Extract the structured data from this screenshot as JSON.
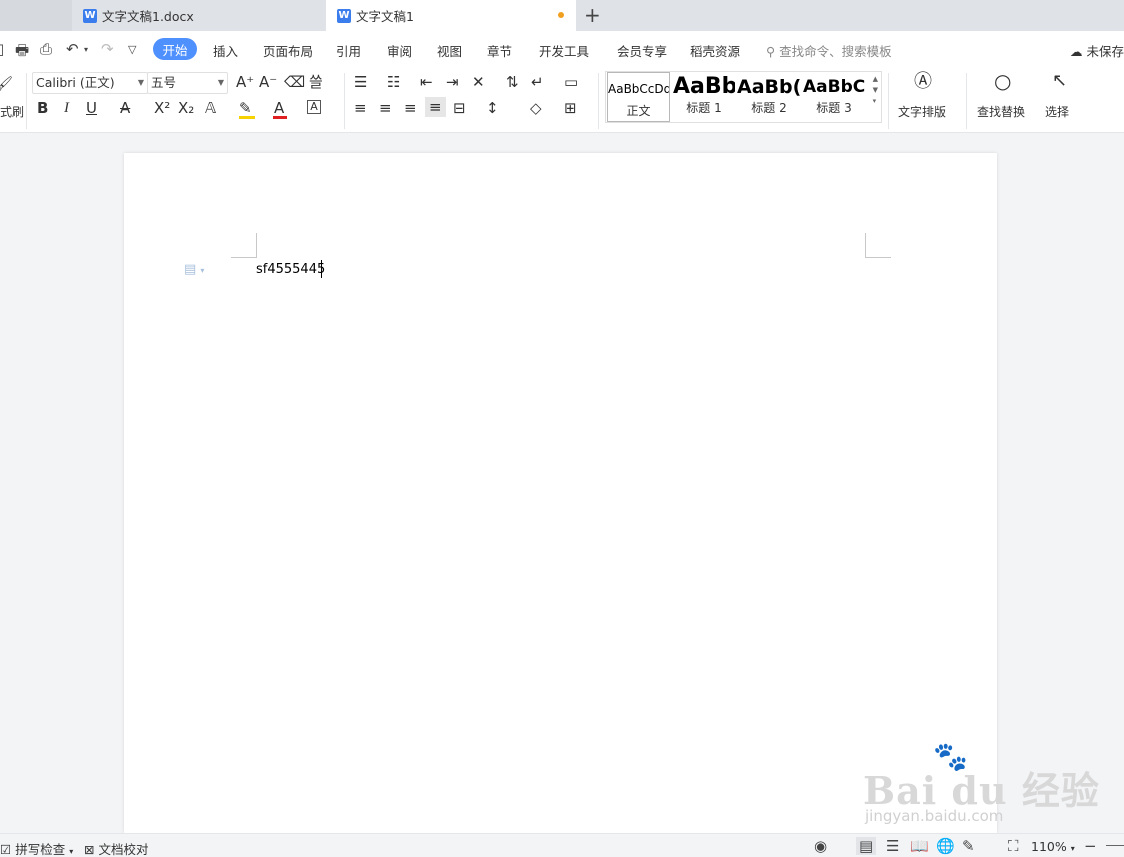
{
  "tabs": [
    {
      "label": "文字文稿1.docx"
    },
    {
      "label": "文字文稿1"
    }
  ],
  "menu": {
    "items": [
      "开始",
      "插入",
      "页面布局",
      "引用",
      "审阅",
      "视图",
      "章节",
      "开发工具",
      "会员专享",
      "稻壳资源"
    ],
    "search_placeholder": "查找命令、搜索模板",
    "save_status": "未保存"
  },
  "ribbon": {
    "format_painter": "式刷",
    "font_name": "Calibri (正文)",
    "font_size": "五号",
    "styles": [
      {
        "sample": "AaBbCcDd",
        "name": "正文"
      },
      {
        "sample": "AaBb",
        "name": "标题 1"
      },
      {
        "sample": "AaBb(",
        "name": "标题 2"
      },
      {
        "sample": "AaBbC(",
        "name": "标题 3"
      }
    ],
    "text_layout": "文字排版",
    "find_replace": "查找替换",
    "select": "选择"
  },
  "document": {
    "body_text": "sf4555445"
  },
  "status": {
    "spell_check": "拼写检查",
    "proofread": "文档校对",
    "zoom": "110%"
  },
  "watermark": {
    "brand": "Bai du 经验",
    "url": "jingyan.baidu.com"
  },
  "colors": {
    "accent": "#4d90fe",
    "highlight": "#f6d200",
    "font_color": "#e02020",
    "unsaved_dot": "#f0a020"
  }
}
